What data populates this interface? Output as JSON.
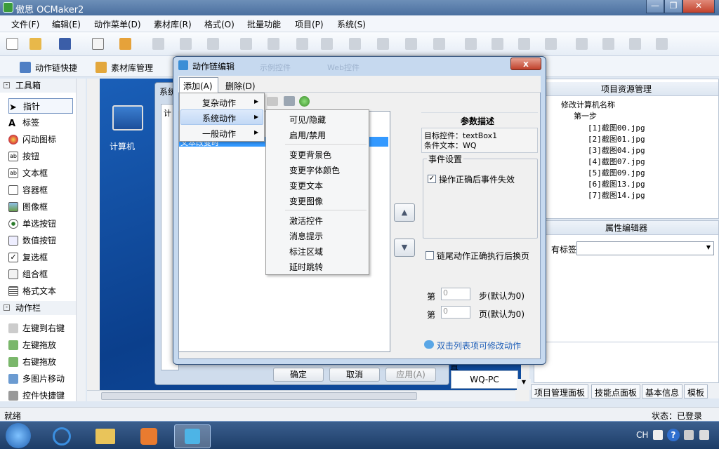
{
  "window": {
    "title": "傲思 OCMaker2",
    "min": "—",
    "restore": "❐",
    "close": "✕"
  },
  "menubar": [
    "文件(F)",
    "编辑(E)",
    "动作菜单(D)",
    "素材库(R)",
    "格式(O)",
    "批量功能",
    "项目(P)",
    "系统(S)"
  ],
  "toolbar2": {
    "action_chain": "动作链快捷",
    "asset_library": "素材库管理"
  },
  "toolbox": {
    "header": "工具箱",
    "items": [
      "指针",
      "标签",
      "闪动图标",
      "按钮",
      "文本框",
      "容器框",
      "图像框",
      "单选按钮",
      "数值按钮",
      "复选框",
      "组合框",
      "格式文本"
    ],
    "action_header": "动作栏",
    "actions": [
      "左键到右键",
      "左键拖放",
      "右键拖放",
      "多图片移动",
      "控件快捷键"
    ]
  },
  "canvas": {
    "desktop_icon_label": "计算机",
    "bg_dialog_title": "系统",
    "bg_dialog_sub": "计",
    "pc_name": "WQ-PC",
    "bg_buttons": [
      "确定",
      "取消",
      "应用(A)"
    ],
    "bg_label_fragment": "置"
  },
  "project_panel": {
    "title": "项目资源管理",
    "root": "修改计算机名称",
    "step": "第一步",
    "files": [
      "[1]截图00.jpg",
      "[2]截图01.jpg",
      "[3]截图04.jpg",
      "[4]截图07.jpg",
      "[5]截图09.jpg",
      "[6]截图13.jpg",
      "[7]截图14.jpg"
    ]
  },
  "property_panel": {
    "title": "属性编辑器",
    "label": "有标签"
  },
  "bottom_tabs": [
    "项目管理面板",
    "技能点面板",
    "基本信息",
    "模板"
  ],
  "status": {
    "left": "就绪",
    "right": "状态：已登录"
  },
  "taskbar": {
    "lang": "CH",
    "help": "?"
  },
  "dialog": {
    "title": "动作链编辑",
    "close": "x",
    "menu": [
      "添加(A)",
      "删除(D)"
    ],
    "list_selected_text": "文本改变时",
    "up": "▲",
    "down": "▼",
    "params_title": "参数描述",
    "target_line": "目标控件：textBox1",
    "cond_line": "条件文本：WQ",
    "event_group": "事件设置",
    "event_check": "操作正确后事件失效",
    "chain_check": "链尾动作正确执行后换页",
    "step_prefix": "第",
    "step_value": "0",
    "step_suffix": "步(默认为0)",
    "page_prefix": "第",
    "page_value": "0",
    "page_suffix": "页(默认为0)",
    "hint": "双击列表项可修改动作",
    "bg_faded_tabs": [
      "示例控件",
      "Web控件"
    ]
  },
  "add_menu": [
    "复杂动作",
    "系统动作",
    "一般动作"
  ],
  "system_menu": {
    "group1": [
      "可见/隐藏",
      "启用/禁用"
    ],
    "group2": [
      "变更背景色",
      "变更字体颜色",
      "变更文本",
      "变更图像"
    ],
    "group3": [
      "激活控件",
      "消息提示",
      "标注区域",
      "延时跳转"
    ]
  }
}
